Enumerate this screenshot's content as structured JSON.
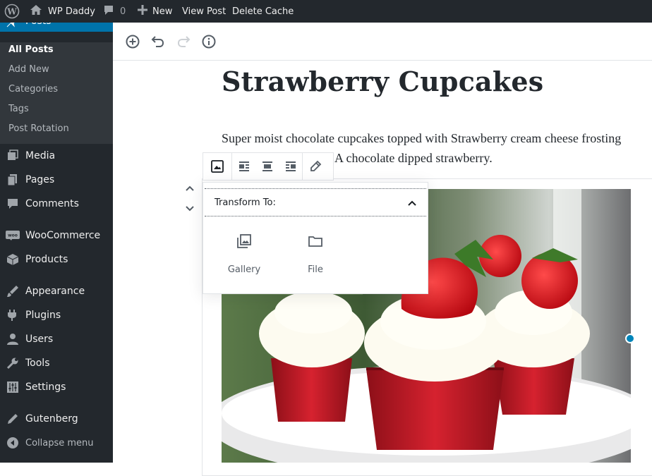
{
  "admin_bar": {
    "wp_logo_icon": "wordpress-logo-icon",
    "site_name": "WP Daddy",
    "comments_count": "0",
    "new_label": "New",
    "view_post_label": "View Post",
    "delete_cache_label": "Delete Cache"
  },
  "sidebar": {
    "current_menu": "Posts",
    "posts_submenu": [
      "All Posts",
      "Add New",
      "Categories",
      "Tags",
      "Post Rotation"
    ],
    "items": [
      {
        "label": "Media",
        "icon": "media-icon"
      },
      {
        "label": "Pages",
        "icon": "pages-icon"
      },
      {
        "label": "Comments",
        "icon": "comments-icon"
      },
      {
        "label": "WooCommerce",
        "icon": "woocommerce-icon"
      },
      {
        "label": "Products",
        "icon": "products-icon"
      },
      {
        "label": "Appearance",
        "icon": "appearance-icon"
      },
      {
        "label": "Plugins",
        "icon": "plugins-icon"
      },
      {
        "label": "Users",
        "icon": "users-icon"
      },
      {
        "label": "Tools",
        "icon": "tools-icon"
      },
      {
        "label": "Settings",
        "icon": "settings-icon"
      },
      {
        "label": "Gutenberg",
        "icon": "gutenberg-icon"
      },
      {
        "label": "Collapse menu",
        "icon": "collapse-icon"
      }
    ]
  },
  "editor": {
    "toolbar_icons": [
      "add-block-icon",
      "undo-icon",
      "redo-icon",
      "info-icon"
    ],
    "post_title": "Strawberry Cupcakes",
    "paragraph": "Super moist chocolate cupcakes topped with Strawberry cream cheese frosting and then the ultimate: A chocolate dipped strawberry.",
    "block_toolbar_icons": [
      "image-block-icon",
      "align-left-icon",
      "align-center-icon",
      "align-right-icon",
      "edit-pencil-icon"
    ],
    "transform": {
      "heading": "Transform To:",
      "options": [
        {
          "label": "Gallery",
          "icon": "gallery-icon"
        },
        {
          "label": "File",
          "icon": "folder-icon"
        }
      ]
    }
  },
  "colors": {
    "admin_dark": "#23282d",
    "submenu_bg": "#32373c",
    "accent_blue": "#0073aa",
    "handle_blue": "#0085ba"
  }
}
